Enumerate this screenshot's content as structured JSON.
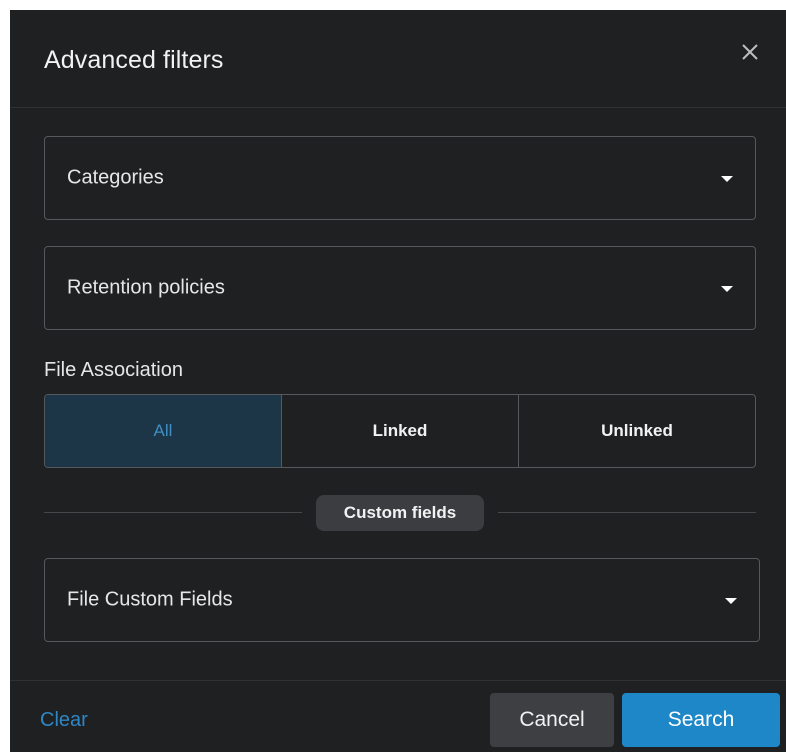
{
  "dialog": {
    "title": "Advanced filters",
    "close_icon": "close-icon"
  },
  "filters": {
    "categories": {
      "label": "Categories",
      "icon": "caret-down-icon"
    },
    "retention_policies": {
      "label": "Retention policies",
      "icon": "caret-down-icon"
    }
  },
  "file_association": {
    "label": "File Association",
    "options": [
      "All",
      "Linked",
      "Unlinked"
    ],
    "selected": "All"
  },
  "custom_fields_divider": {
    "label": "Custom fields"
  },
  "custom_fields": {
    "file_custom_fields": {
      "label": "File Custom Fields",
      "icon": "caret-down-icon"
    }
  },
  "footer": {
    "clear_label": "Clear",
    "cancel_label": "Cancel",
    "search_label": "Search"
  },
  "colors": {
    "background": "#1f2022",
    "accent": "#1d87c7",
    "link": "#2f86c4",
    "selected_segment_bg": "#1c3547",
    "selected_segment_text": "#3f8fc4"
  }
}
